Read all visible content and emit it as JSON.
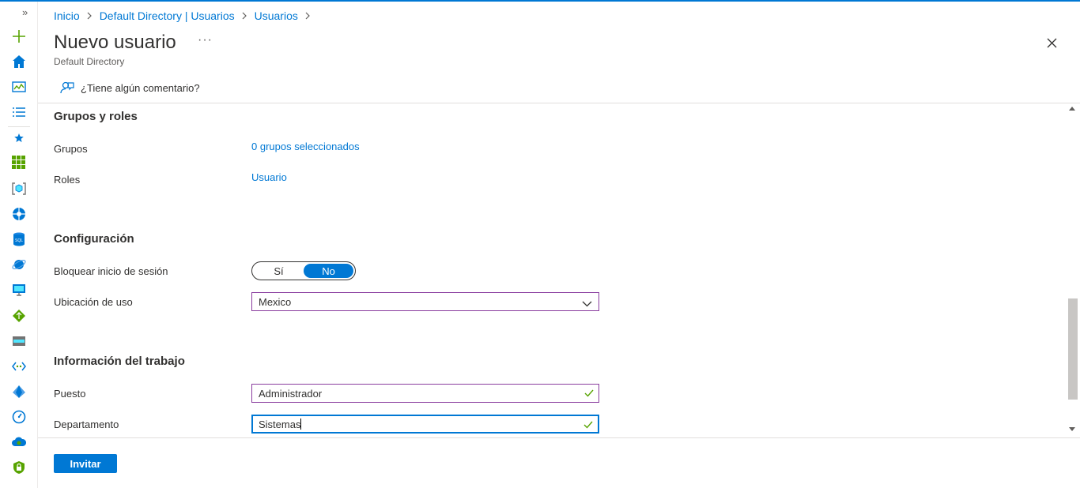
{
  "nav": {
    "expand_glyph": "»",
    "icons": [
      "plus-icon",
      "home-icon",
      "dashboard-icon",
      "list-icon",
      "star-icon",
      "all-services-icon",
      "resource-group-icon",
      "app-services-icon",
      "sql-icon",
      "cosmos-icon",
      "virtual-machine-icon",
      "load-balancer-icon",
      "storage-icon",
      "virtual-network-icon",
      "azure-ad-icon",
      "monitor-icon",
      "advisor-icon",
      "security-center-icon"
    ]
  },
  "breadcrumb": {
    "items": [
      "Inicio",
      "Default Directory | Usuarios",
      "Usuarios"
    ]
  },
  "header": {
    "title": "Nuevo usuario",
    "more": "···",
    "subtitle": "Default Directory"
  },
  "feedback": {
    "label": "¿Tiene algún comentario?"
  },
  "groups_roles": {
    "title": "Grupos y roles",
    "groups_label": "Grupos",
    "groups_value": "0 grupos seleccionados",
    "roles_label": "Roles",
    "roles_value": "Usuario"
  },
  "configuration": {
    "title": "Configuración",
    "block_label": "Bloquear inicio de sesión",
    "block_yes": "Sí",
    "block_no": "No",
    "block_selected": "No",
    "location_label": "Ubicación de uso",
    "location_value": "Mexico"
  },
  "job_info": {
    "title": "Información del trabajo",
    "job_label": "Puesto",
    "job_value": "Administrador",
    "dept_label": "Departamento",
    "dept_value": "Sistemas"
  },
  "footer": {
    "invite_label": "Invitar"
  },
  "colors": {
    "accent": "#0078d4",
    "field_border": "#8a3d9f",
    "valid_check": "#57a300"
  }
}
